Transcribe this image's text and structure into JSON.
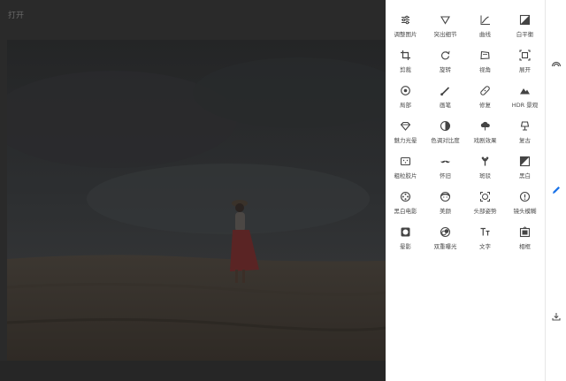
{
  "header": {
    "open_label": "打开"
  },
  "tools": [
    {
      "id": "tune",
      "label": "调整图片",
      "icon": "sliders-icon"
    },
    {
      "id": "details",
      "label": "突出细节",
      "icon": "triangle-down-icon"
    },
    {
      "id": "curves",
      "label": "曲线",
      "icon": "curve-icon"
    },
    {
      "id": "wb",
      "label": "白平衡",
      "icon": "white-balance-icon"
    },
    {
      "id": "crop",
      "label": "剪裁",
      "icon": "crop-icon"
    },
    {
      "id": "rotate",
      "label": "旋转",
      "icon": "rotate-icon"
    },
    {
      "id": "perspective",
      "label": "视角",
      "icon": "perspective-icon"
    },
    {
      "id": "expand",
      "label": "展开",
      "icon": "expand-icon"
    },
    {
      "id": "selective",
      "label": "局部",
      "icon": "target-icon"
    },
    {
      "id": "brush",
      "label": "画笔",
      "icon": "brush-icon"
    },
    {
      "id": "healing",
      "label": "修复",
      "icon": "bandage-icon"
    },
    {
      "id": "hdr",
      "label": "HDR 景观",
      "icon": "mountain-icon"
    },
    {
      "id": "glamour",
      "label": "魅力光晕",
      "icon": "diamond-icon"
    },
    {
      "id": "tonal",
      "label": "色调对比度",
      "icon": "half-circle-icon"
    },
    {
      "id": "drama",
      "label": "戏剧效果",
      "icon": "cloud-icon"
    },
    {
      "id": "vintage",
      "label": "复古",
      "icon": "lamp-icon"
    },
    {
      "id": "grainy",
      "label": "粗粒胶片",
      "icon": "film-icon"
    },
    {
      "id": "retrolux",
      "label": "怀旧",
      "icon": "mustache-icon"
    },
    {
      "id": "grunge",
      "label": "斑驳",
      "icon": "grunge-icon"
    },
    {
      "id": "bw",
      "label": "黑白",
      "icon": "bw-icon"
    },
    {
      "id": "noir",
      "label": "黑白电影",
      "icon": "film-reel-icon"
    },
    {
      "id": "portrait",
      "label": "美颜",
      "icon": "face-icon"
    },
    {
      "id": "headpose",
      "label": "头部姿势",
      "icon": "head-pose-icon"
    },
    {
      "id": "lensblur",
      "label": "镜头模糊",
      "icon": "lens-blur-icon"
    },
    {
      "id": "vignette",
      "label": "晕影",
      "icon": "vignette-icon"
    },
    {
      "id": "double",
      "label": "双重曝光",
      "icon": "double-exposure-icon"
    },
    {
      "id": "text",
      "label": "文字",
      "icon": "text-icon"
    },
    {
      "id": "frames",
      "label": "相框",
      "icon": "frame-icon"
    }
  ],
  "rail": [
    {
      "id": "looks",
      "icon": "rainbow-icon"
    },
    {
      "id": "tools",
      "icon": "pencil-icon",
      "active": true,
      "color": "#1a73e8"
    },
    {
      "id": "export",
      "icon": "download-icon"
    }
  ]
}
